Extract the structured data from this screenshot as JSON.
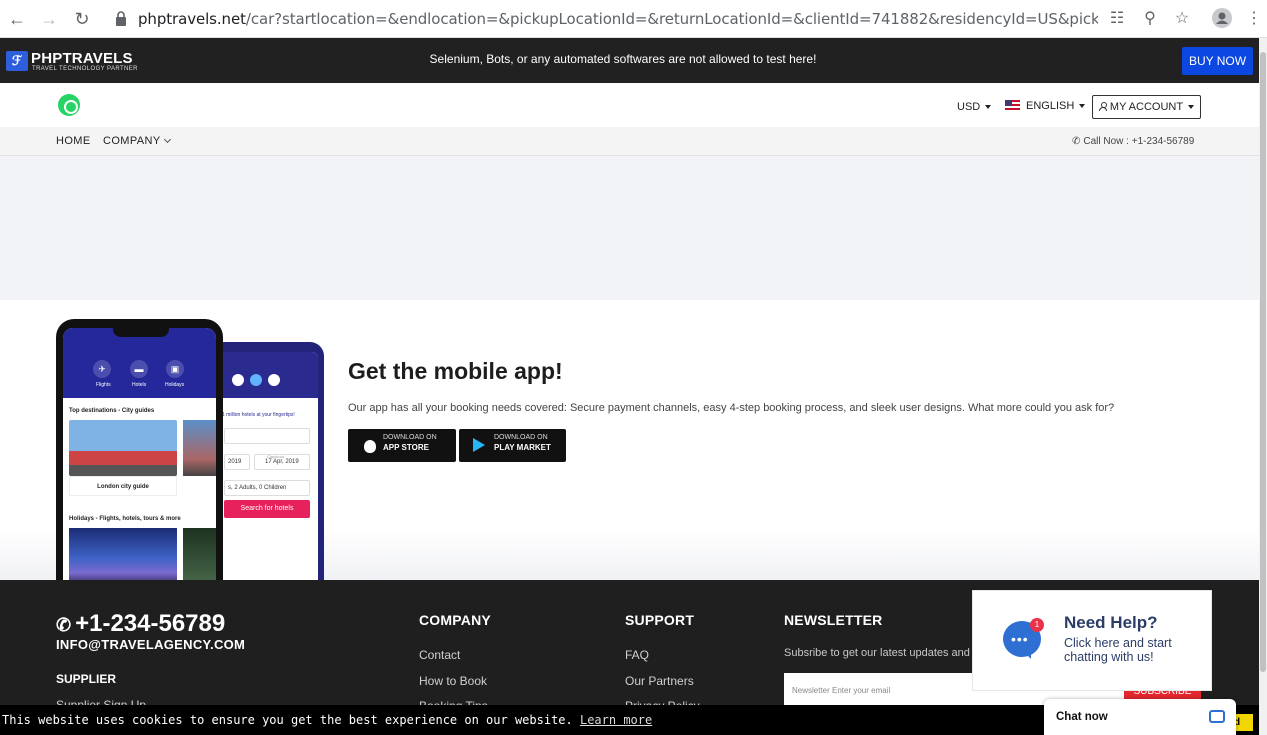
{
  "browser": {
    "url_host": "phptravels.net",
    "url_path": "/car?startlocation=&endlocation=&pickupLocationId=&returnLocationId=&clientId=741882&residencyId=US&pickup..."
  },
  "topbar": {
    "logo_name": "PHPTRAVELS",
    "logo_tagline": "TRAVEL TECHNOLOGY PARTNER",
    "notice": "Selenium, Bots, or any automated softwares are not allowed to test here!",
    "buy_now": "BUY NOW"
  },
  "header": {
    "currency": "USD",
    "language": "ENGLISH",
    "account": "MY ACCOUNT"
  },
  "nav": {
    "home": "HOME",
    "company": "COMPANY",
    "call": "Call Now : +1-234-56789"
  },
  "app_section": {
    "title": "Get the mobile app!",
    "description": "Our app has all your booking needs covered: Secure payment channels, easy 4-step booking process, and sleek user designs. What more could you ask for?",
    "app_store": {
      "line1": "DOWNLOAD ON",
      "line2": "APP STORE"
    },
    "play_market": {
      "line1": "DOWNLOAD ON",
      "line2": "PLAY MARKET"
    },
    "mockup": {
      "tabs": [
        "Flights",
        "Hotels",
        "Holidays"
      ],
      "section1": "Top destinations - City guides",
      "card_caption": "London city guide",
      "section2": "Holidays - Flights, hotels, tours & more",
      "back_tagline": "1 million hotels at your fingertips!",
      "back_date_in": "2019",
      "back_checkout_label": "Checkout",
      "back_date_out": "17 Apr, 2019",
      "back_guests": "s, 2 Adults, 0 Children",
      "back_search": "Search for hotels"
    }
  },
  "footer": {
    "phone": "+1-234-56789",
    "email": "INFO@TRAVELAGENCY.COM",
    "supplier_heading": "SUPPLIER",
    "supplier_link": "Supplier Sign Up",
    "company_heading": "COMPANY",
    "company_links": [
      "Contact",
      "How to Book",
      "Booking Tips"
    ],
    "support_heading": "SUPPORT",
    "support_links": [
      "FAQ",
      "Our Partners",
      "Privacy Policy"
    ],
    "newsletter_heading": "NEWSLETTER",
    "newsletter_text": "Subsribe to get our latest updates and",
    "newsletter_placeholder": "Newsletter Enter your email",
    "subscribe": "SUBSCRIBE"
  },
  "chat": {
    "badge": "1",
    "title": "Need Help?",
    "text": "Click here and start chatting with us!",
    "chat_now": "Chat now"
  },
  "cookie": {
    "text": "This website uses cookies to ensure you get the best experience on our website.",
    "learn_more": "Learn more",
    "got_it": "d"
  },
  "colors": {
    "buy_now": "#0d47e1",
    "topbar": "#212121",
    "footer": "#1f1f1f",
    "subscribe": "#e3262f",
    "search_button": "#e6215b",
    "chat_blue": "#2e6fd4"
  }
}
